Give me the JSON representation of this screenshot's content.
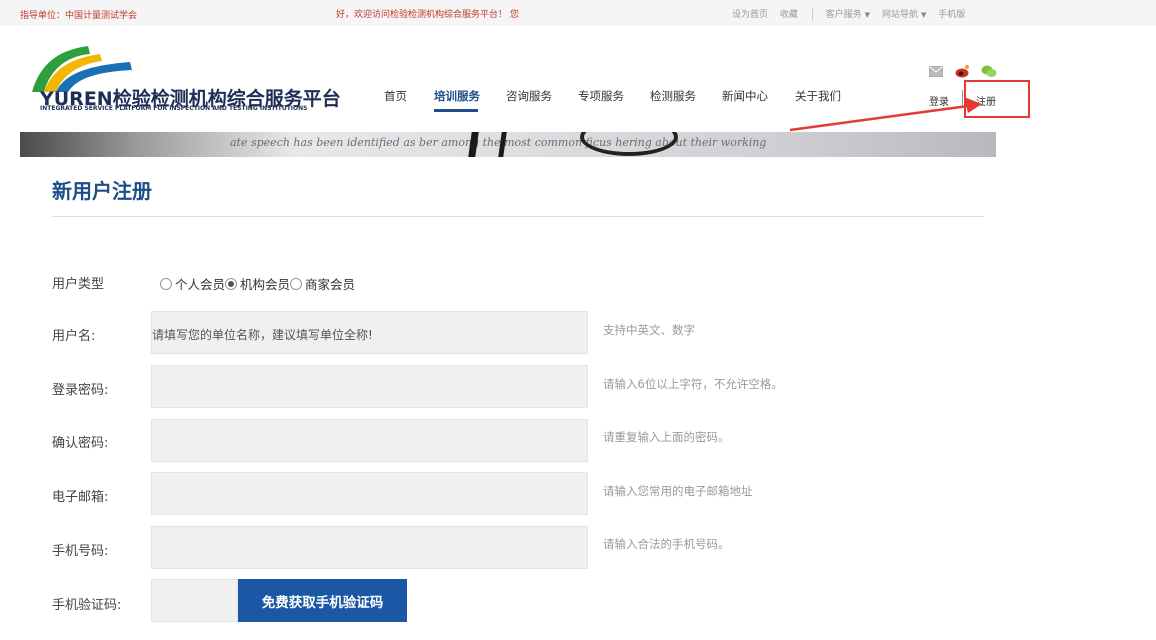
{
  "topbar": {
    "guide": "指导单位：中国计量测试学会",
    "welcome": "好，欢迎访问检验检测机构综合服务平台！  您",
    "set_home": "设为首页",
    "favorite": "收藏",
    "customer_service": "客户服务",
    "site_nav": "网站导航",
    "mobile": "手机版"
  },
  "logo": {
    "brand": "YUREN检验检测机构综合服务平台",
    "subtitle": "INTEGRATED SERVICE PLATFORM FOR INSPECTION AND TESTING INSTITUTIONS"
  },
  "nav": {
    "items": [
      "首页",
      "培训服务",
      "咨询服务",
      "专项服务",
      "检测服务",
      "新闻中心",
      "关于我们"
    ],
    "active_index": 1
  },
  "header_icons": [
    "mail-icon",
    "weibo-icon",
    "wechat-icon"
  ],
  "auth": {
    "login": "登录",
    "register": "注册"
  },
  "banner": {
    "text": "ate speech has been identified as   ber among the most common ficus  hering about their working"
  },
  "page": {
    "title": "新用户注册"
  },
  "form": {
    "user_type": {
      "label": "用户类型",
      "options": [
        "个人会员",
        "机构会员",
        "商家会员"
      ],
      "selected_index": 1
    },
    "username": {
      "label": "用户名:",
      "placeholder": "请填写您的单位名称，建议填写单位全称!",
      "hint": "支持中英文、数字"
    },
    "password": {
      "label": "登录密码:",
      "hint": "请输入6位以上字符，不允许空格。"
    },
    "confirm_password": {
      "label": "确认密码:",
      "hint": "请重复输入上面的密码。"
    },
    "email": {
      "label": "电子邮箱:",
      "hint": "请输入您常用的电子邮箱地址"
    },
    "phone": {
      "label": "手机号码:",
      "hint": "请输入合法的手机号码。"
    },
    "sms_code": {
      "label": "手机验证码:",
      "button": "免费获取手机验证码"
    }
  },
  "colors": {
    "brand_blue": "#1d4e89",
    "button_blue": "#1a58a5",
    "annotation_red": "#e53935"
  }
}
